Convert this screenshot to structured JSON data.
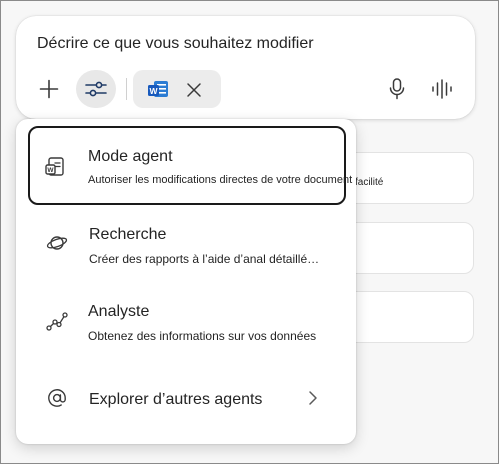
{
  "composer": {
    "prompt_text": "Décrire ce que vous souhaitez modifier",
    "add_icon": "plus-icon",
    "tools_icon": "sliders-icon",
    "attachment_icon": "word-document-icon",
    "remove_icon": "close-icon",
    "mic_icon": "microphone-icon",
    "voice_icon": "voice-waveform-icon"
  },
  "background_cards": {
    "first_card_fragment": "facilité"
  },
  "menu": {
    "items": [
      {
        "title": "Mode agent",
        "subtitle": "Autoriser les modifications directes de votre document",
        "icon": "agent-document-icon",
        "selected": true
      },
      {
        "title": "Recherche",
        "subtitle": "Créer des rapports à l’aide d’anal détaillé…",
        "icon": "planet-icon"
      },
      {
        "title": "Analyste",
        "subtitle": "Obtenez des informations sur vos données",
        "icon": "line-graph-icon"
      },
      {
        "title": "Explorer d’autres agents",
        "icon": "at-sign-icon",
        "trailing_icon": "chevron-right-icon"
      }
    ]
  },
  "colors": {
    "selected_border": "#1a1a1a",
    "tools_button_bg": "#e8e8e8",
    "chip_bg": "#ececec",
    "word_blue": "#185abd"
  }
}
